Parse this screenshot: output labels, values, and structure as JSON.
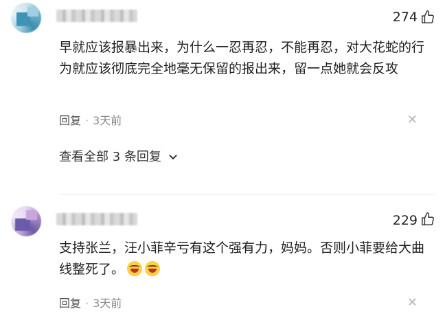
{
  "comments": [
    {
      "likes": "274",
      "text": "早就应该报暴出来，为什么一忍再忍，不能再忍，对大花蛇的行为就应该彻底完全地毫无保留的报出来，留一点她就会反攻",
      "reply_label": "回复",
      "separator": "·",
      "time": "3天前",
      "view_replies": "查看全部 3 条回复"
    },
    {
      "likes": "229",
      "text": "支持张兰，汪小菲辛亏有这个强有力，妈妈。否则小菲要给大曲线整死了。",
      "reply_label": "回复",
      "separator": "·",
      "time": "3天前"
    }
  ],
  "icons": {
    "like": "thumbs-up-icon",
    "close": "close-icon",
    "chevron": "chevron-down-icon",
    "emoji": "laughing-crying-emoji"
  },
  "glyphs": {
    "close": "✕",
    "chevron": "⌄"
  }
}
